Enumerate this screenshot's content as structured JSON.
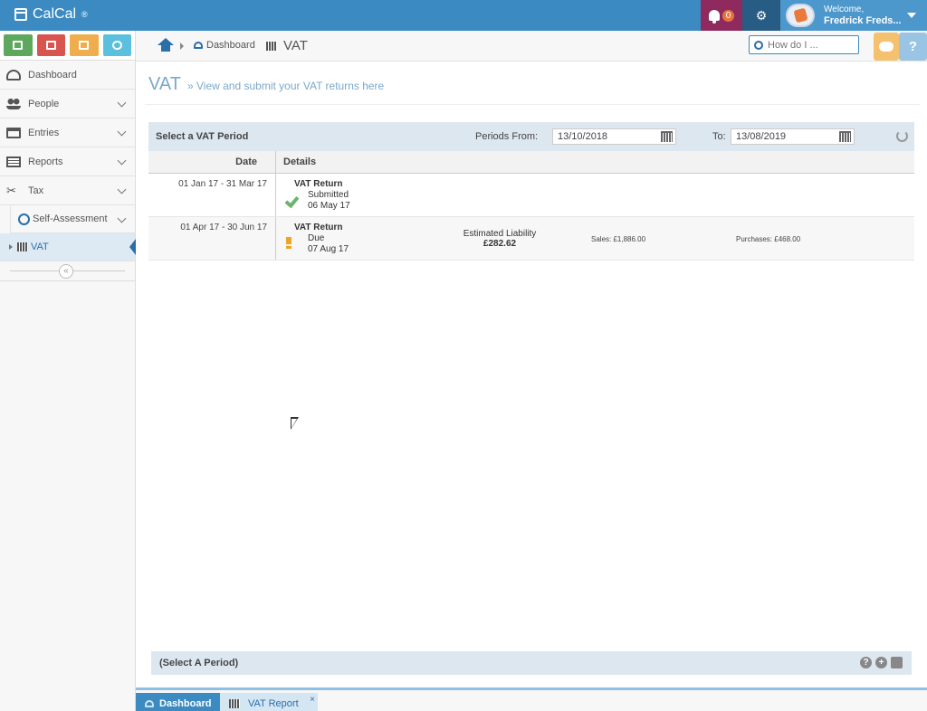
{
  "app": {
    "name": "CalCal",
    "trademark": "®"
  },
  "topbar": {
    "notification_count": "0",
    "welcome": "Welcome,",
    "user_name": "Fredrick Freds...",
    "colors": {
      "bar": "#3b8bc2",
      "notif": "#8e2a5e",
      "settings": "#275d84"
    }
  },
  "quick_actions": [
    {
      "icon": "calendar-plus-icon",
      "color": "#5ea85e"
    },
    {
      "icon": "calendar-minus-icon",
      "color": "#d9534f"
    },
    {
      "icon": "calendar-grid-icon",
      "color": "#f0ad4e"
    },
    {
      "icon": "gear-icon",
      "color": "#5bc0de"
    }
  ],
  "sidebar": {
    "items": [
      {
        "label": "Dashboard",
        "icon": "dashboard-icon"
      },
      {
        "label": "People",
        "icon": "people-icon"
      },
      {
        "label": "Entries",
        "icon": "calendar-icon"
      },
      {
        "label": "Reports",
        "icon": "reports-icon"
      },
      {
        "label": "Tax",
        "icon": "scissors-icon"
      }
    ],
    "sub_items": [
      {
        "label": "Self-Assessment",
        "icon": "self-assessment-icon"
      },
      {
        "label": "VAT",
        "icon": "vat-icon"
      }
    ]
  },
  "breadcrumb": {
    "dashboard": "Dashboard",
    "current": "VAT"
  },
  "search": {
    "placeholder": "How do I ..."
  },
  "page": {
    "title": "VAT",
    "subtitle": "» View and submit your VAT returns here"
  },
  "period": {
    "label": "Select a VAT Period",
    "from_label": "Periods From:",
    "from_value": "13/10/2018",
    "to_label": "To:",
    "to_value": "13/08/2019"
  },
  "table": {
    "headers": {
      "date": "Date",
      "details": "Details"
    },
    "rows": [
      {
        "date": "01 Jan 17 - 31 Mar 17",
        "kind": "VAT Return",
        "status": "Submitted",
        "status_date": "06 May 17",
        "icon": "check-icon"
      },
      {
        "date": "01 Apr 17 - 30 Jun 17",
        "kind": "VAT Return",
        "status": "Due",
        "status_date": "07 Aug 17",
        "icon": "exclamation-icon",
        "liability_label": "Estimated Liability",
        "liability_value": "£282.62",
        "sales": "Sales: £1,886.00",
        "purchases": "Purchases: £468.00"
      }
    ]
  },
  "footer": {
    "label": "(Select A Period)"
  },
  "tabs": [
    {
      "label": "Dashboard"
    },
    {
      "label": "VAT Report",
      "close": "×"
    }
  ]
}
